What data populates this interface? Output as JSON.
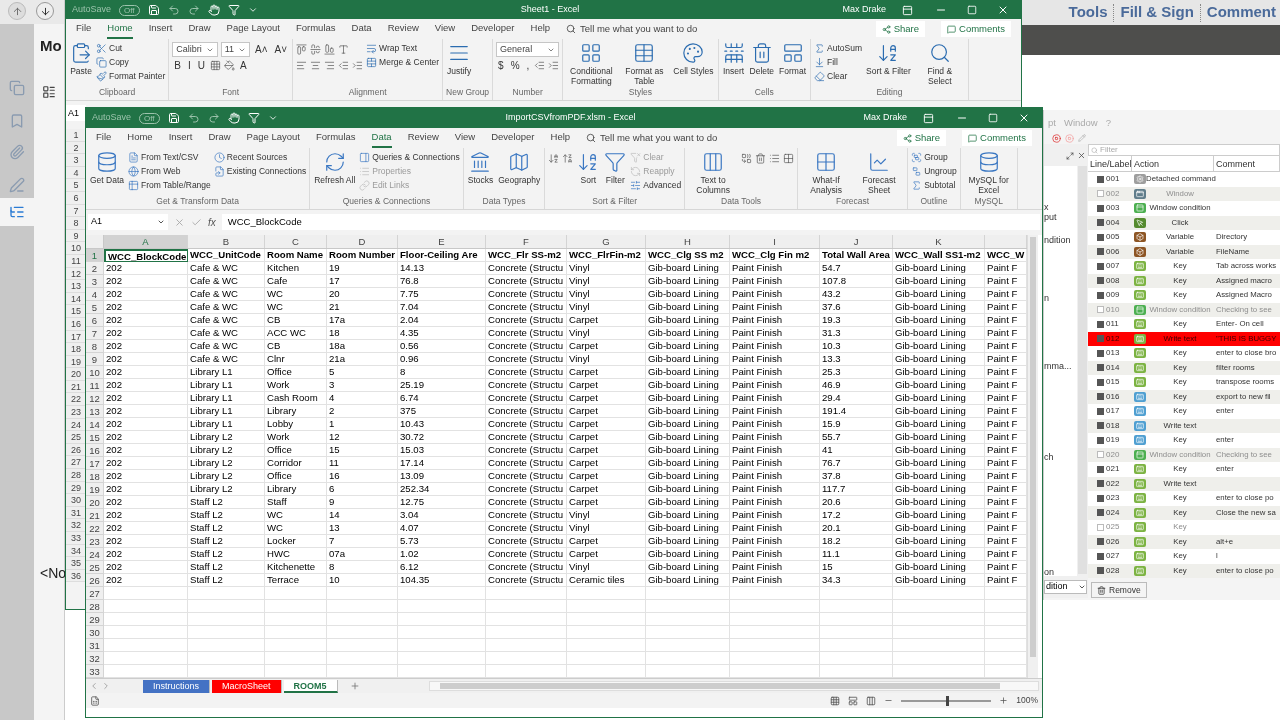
{
  "pdf_viewer": {
    "toolbar": [
      "Tools",
      "Fill & Sign",
      "Comment"
    ],
    "panel_title": "Mo",
    "panel_note": "<No",
    "side_tabs": [
      {
        "selected": false
      },
      {
        "selected": false
      },
      {
        "selected": false
      },
      {
        "selected": false
      },
      {
        "selected": true
      }
    ]
  },
  "back_window": {
    "autosave": "AutoSave",
    "autosave_state": "Off",
    "title": "Sheet1  -  Excel",
    "user": "Max Drake",
    "tabs": [
      {
        "label": "File",
        "selected": false
      },
      {
        "label": "Home",
        "selected": true
      },
      {
        "label": "Insert",
        "selected": false
      },
      {
        "label": "Draw",
        "selected": false
      },
      {
        "label": "Page Layout",
        "selected": false
      },
      {
        "label": "Formulas",
        "selected": false
      },
      {
        "label": "Data",
        "selected": false
      },
      {
        "label": "Review",
        "selected": false
      },
      {
        "label": "View",
        "selected": false
      },
      {
        "label": "Developer",
        "selected": false
      },
      {
        "label": "Help",
        "selected": false
      }
    ],
    "search": "Tell me what you want to do",
    "share": "Share",
    "comments": "Comments",
    "ribbon": [
      {
        "label": "Clipboard",
        "columns": [
          [
            {
              "kind": "large",
              "label": "Paste"
            }
          ],
          [
            {
              "kind": "small",
              "label": "Cut"
            },
            {
              "kind": "small",
              "label": "Copy"
            },
            {
              "kind": "small",
              "label": "Format Painter"
            }
          ]
        ]
      },
      {
        "label": "Font",
        "columns": [
          [
            {
              "kind": "row",
              "items": [
                {
                  "kind": "field",
                  "value": "Calibri"
                },
                {
                  "kind": "field",
                  "value": "11"
                },
                {
                  "kind": "glyphs",
                  "glyphs": [
                    "A˄",
                    "A˅"
                  ]
                }
              ]
            },
            {
              "kind": "row",
              "items": [
                {
                  "kind": "glyphs",
                  "glyphs": [
                    "B",
                    "I",
                    "U"
                  ]
                },
                {
                  "kind": "iconrow"
                },
                {
                  "kind": "glyphs",
                  "glyphs": [
                    "A"
                  ]
                }
              ]
            }
          ]
        ]
      },
      {
        "label": "Alignment",
        "columns": [
          [
            {
              "kind": "iconrow"
            },
            {
              "kind": "iconrow"
            }
          ],
          [
            {
              "kind": "small",
              "label": "Wrap Text"
            },
            {
              "kind": "small",
              "label": "Merge & Center"
            }
          ]
        ]
      },
      {
        "label": "New Group",
        "columns": [
          [
            {
              "kind": "large",
              "label": "Justify"
            }
          ]
        ]
      },
      {
        "label": "Number",
        "columns": [
          [
            {
              "kind": "field",
              "value": "General"
            },
            {
              "kind": "row",
              "items": [
                {
                  "kind": "glyphs",
                  "glyphs": [
                    "$",
                    "%",
                    ","
                  ]
                },
                {
                  "kind": "iconrow"
                }
              ]
            }
          ]
        ]
      },
      {
        "label": "Styles",
        "columns": [
          [
            {
              "kind": "large",
              "label": "Conditional Formatting"
            }
          ],
          [
            {
              "kind": "large",
              "label": "Format as Table"
            }
          ],
          [
            {
              "kind": "large",
              "label": "Cell Styles"
            }
          ]
        ]
      },
      {
        "label": "Cells",
        "columns": [
          [
            {
              "kind": "large",
              "label": "Insert"
            }
          ],
          [
            {
              "kind": "large",
              "label": "Delete"
            }
          ],
          [
            {
              "kind": "large",
              "label": "Format"
            }
          ]
        ]
      },
      {
        "label": "Editing",
        "columns": [
          [
            {
              "kind": "small",
              "label": "AutoSum"
            },
            {
              "kind": "small",
              "label": "Fill"
            },
            {
              "kind": "small",
              "label": "Clear"
            }
          ],
          [
            {
              "kind": "large",
              "label": "Sort & Filter"
            }
          ],
          [
            {
              "kind": "large",
              "label": "Find & Select"
            }
          ]
        ]
      }
    ],
    "name_box": "A1",
    "row_numbers": [
      "1",
      "2",
      "3",
      "4",
      "5",
      "6",
      "7",
      "8",
      "9",
      "10",
      "11",
      "12",
      "13",
      "14",
      "15",
      "16",
      "17",
      "18",
      "19",
      "20",
      "21",
      "22",
      "23",
      "24",
      "25",
      "26",
      "27",
      "28",
      "29",
      "30",
      "31",
      "32",
      "33",
      "34",
      "35",
      "36"
    ]
  },
  "front_window": {
    "autosave": "AutoSave",
    "autosave_state": "Off",
    "title": "ImportCSVfromPDF.xlsm  -  Excel",
    "user": "Max Drake",
    "tabs": [
      {
        "label": "File",
        "selected": false
      },
      {
        "label": "Home",
        "selected": false
      },
      {
        "label": "Insert",
        "selected": false
      },
      {
        "label": "Draw",
        "selected": false
      },
      {
        "label": "Page Layout",
        "selected": false
      },
      {
        "label": "Formulas",
        "selected": false
      },
      {
        "label": "Data",
        "selected": true
      },
      {
        "label": "Review",
        "selected": false
      },
      {
        "label": "View",
        "selected": false
      },
      {
        "label": "Developer",
        "selected": false
      },
      {
        "label": "Help",
        "selected": false
      }
    ],
    "search": "Tell me what you want to do",
    "share": "Share",
    "comments": "Comments",
    "ribbon": [
      {
        "label": "Get & Transform Data",
        "columns": [
          [
            {
              "kind": "large",
              "label": "Get Data",
              "disabled": false
            }
          ],
          [
            {
              "kind": "small",
              "label": "From Text/CSV",
              "disabled": false
            },
            {
              "kind": "small",
              "label": "From Web",
              "disabled": false
            },
            {
              "kind": "small",
              "label": "From Table/Range",
              "disabled": false
            }
          ],
          [
            {
              "kind": "small",
              "label": "Recent Sources",
              "disabled": false
            },
            {
              "kind": "small",
              "label": "Existing Connections",
              "disabled": false
            }
          ]
        ]
      },
      {
        "label": "Queries & Connections",
        "columns": [
          [
            {
              "kind": "large",
              "label": "Refresh All",
              "disabled": false
            }
          ],
          [
            {
              "kind": "small",
              "label": "Queries & Connections",
              "disabled": false
            },
            {
              "kind": "small",
              "label": "Properties",
              "disabled": true
            },
            {
              "kind": "small",
              "label": "Edit Links",
              "disabled": true
            }
          ]
        ]
      },
      {
        "label": "Data Types",
        "columns": [
          [
            {
              "kind": "large",
              "label": "Stocks",
              "disabled": false
            }
          ],
          [
            {
              "kind": "large",
              "label": "Geography",
              "disabled": false
            }
          ]
        ]
      },
      {
        "label": "Sort & Filter",
        "columns": [
          [
            {
              "kind": "iconrow"
            }
          ],
          [
            {
              "kind": "large",
              "label": "Sort",
              "disabled": false
            }
          ],
          [
            {
              "kind": "large",
              "label": "Filter",
              "disabled": false
            }
          ],
          [
            {
              "kind": "small",
              "label": "Clear",
              "disabled": true
            },
            {
              "kind": "small",
              "label": "Reapply",
              "disabled": true
            },
            {
              "kind": "small",
              "label": "Advanced",
              "disabled": false
            }
          ]
        ]
      },
      {
        "label": "Data Tools",
        "columns": [
          [
            {
              "kind": "large",
              "label": "Text to Columns",
              "disabled": false
            }
          ],
          [
            {
              "kind": "iconrow"
            }
          ]
        ]
      },
      {
        "label": "Forecast",
        "columns": [
          [
            {
              "kind": "large",
              "label": "What-If Analysis",
              "disabled": false
            }
          ],
          [
            {
              "kind": "large",
              "label": "Forecast Sheet",
              "disabled": false
            }
          ]
        ]
      },
      {
        "label": "Outline",
        "columns": [
          [
            {
              "kind": "small",
              "label": "Group",
              "disabled": false
            },
            {
              "kind": "small",
              "label": "Ungroup",
              "disabled": false
            },
            {
              "kind": "small",
              "label": "Subtotal",
              "disabled": false
            }
          ]
        ]
      },
      {
        "label": "MySQL",
        "columns": [
          [
            {
              "kind": "large",
              "label": "MySQL for Excel",
              "disabled": false
            }
          ]
        ]
      }
    ],
    "name_box": "A1",
    "formula_label": "fx",
    "formula": "WCC_BlockCode",
    "column_letters": [
      "A",
      "B",
      "C",
      "D",
      "E",
      "F",
      "G",
      "H",
      "I",
      "J",
      "K"
    ],
    "rows": [
      {
        "n": "1",
        "cells": [
          "WCC_BlockCode",
          "WCC_UnitCode",
          "Room Name",
          "Room Number",
          "Floor-Ceiling Are",
          "WCC_Flr SS-m2",
          "WCC_FlrFin-m2",
          "WCC_Clg SS m2",
          "WCC_Clg Fin m2",
          "Total Wall Area",
          "WCC_Wall SS1-m2",
          "WCC_W"
        ]
      },
      {
        "n": "2",
        "cells": [
          "202",
          "Cafe & WC",
          "Kitchen",
          "19",
          "14.13",
          "Concrete (Structu",
          "Vinyl",
          "Gib-board Lining",
          "Paint Finish",
          "54.7",
          "Gib-board Lining",
          "Paint F"
        ]
      },
      {
        "n": "3",
        "cells": [
          "202",
          "Cafe & WC",
          "Cafe",
          "17",
          "76.8",
          "Concrete (Structu",
          "Vinyl",
          "Gib-board Lining",
          "Paint Finish",
          "107.8",
          "Gib-board Lining",
          "Paint F"
        ]
      },
      {
        "n": "4",
        "cells": [
          "202",
          "Cafe & WC",
          "WC",
          "20",
          "7.75",
          "Concrete (Structu",
          "Vinyl",
          "Gib-board Lining",
          "Paint Finish",
          "43.2",
          "Gib-board Lining",
          "Paint F"
        ]
      },
      {
        "n": "5",
        "cells": [
          "202",
          "Cafe & WC",
          "WC",
          "21",
          "7.04",
          "Concrete (Structu",
          "Vinyl",
          "Gib-board Lining",
          "Paint Finish",
          "37.6",
          "Gib-board Lining",
          "Paint F"
        ]
      },
      {
        "n": "6",
        "cells": [
          "202",
          "Cafe & WC",
          "CB",
          "17a",
          "2.04",
          "Concrete (Structu",
          "Carpet",
          "Gib-board Lining",
          "Paint Finish",
          "19.3",
          "Gib-board Lining",
          "Paint F"
        ]
      },
      {
        "n": "7",
        "cells": [
          "202",
          "Cafe & WC",
          "ACC WC",
          "18",
          "4.35",
          "Concrete (Structu",
          "Vinyl",
          "Gib-board Lining",
          "Paint Finish",
          "31.3",
          "Gib-board Lining",
          "Paint F"
        ]
      },
      {
        "n": "8",
        "cells": [
          "202",
          "Cafe & WC",
          "CB",
          "18a",
          "0.56",
          "Concrete (Structu",
          "Carpet",
          "Gib-board Lining",
          "Paint Finish",
          "10.3",
          "Gib-board Lining",
          "Paint F"
        ]
      },
      {
        "n": "9",
        "cells": [
          "202",
          "Cafe & WC",
          "Clnr",
          "21a",
          "0.96",
          "Concrete (Structu",
          "Vinyl",
          "Gib-board Lining",
          "Paint Finish",
          "13.3",
          "Gib-board Lining",
          "Paint F"
        ]
      },
      {
        "n": "10",
        "cells": [
          "202",
          "Library L1",
          "Office",
          "5",
          "8",
          "Concrete (Structu",
          "Carpet",
          "Gib-board Lining",
          "Paint Finish",
          "25.3",
          "Gib-board Lining",
          "Paint F"
        ]
      },
      {
        "n": "11",
        "cells": [
          "202",
          "Library L1",
          "Work",
          "3",
          "25.19",
          "Concrete (Structu",
          "Carpet",
          "Gib-board Lining",
          "Paint Finish",
          "46.9",
          "Gib-board Lining",
          "Paint F"
        ]
      },
      {
        "n": "12",
        "cells": [
          "202",
          "Library L1",
          "Cash Room",
          "4",
          "6.74",
          "Concrete (Structu",
          "Carpet",
          "Gib-board Lining",
          "Paint Finish",
          "29.4",
          "Gib-board Lining",
          "Paint F"
        ]
      },
      {
        "n": "13",
        "cells": [
          "202",
          "Library L1",
          "Library",
          "2",
          "375",
          "Concrete (Structu",
          "Carpet",
          "Gib-board Lining",
          "Paint Finish",
          "191.4",
          "Gib-board Lining",
          "Paint F"
        ]
      },
      {
        "n": "14",
        "cells": [
          "202",
          "Library L1",
          "Lobby",
          "1",
          "10.43",
          "Concrete (Structu",
          "Carpet",
          "Gib-board Lining",
          "Paint Finish",
          "15.9",
          "Gib-board Lining",
          "Paint F"
        ]
      },
      {
        "n": "15",
        "cells": [
          "202",
          "Library L2",
          "Work",
          "12",
          "30.72",
          "Concrete (Structu",
          "Carpet",
          "Gib-board Lining",
          "Paint Finish",
          "55.7",
          "Gib-board Lining",
          "Paint F"
        ]
      },
      {
        "n": "16",
        "cells": [
          "202",
          "Library L2",
          "Office",
          "15",
          "15.03",
          "Concrete (Structu",
          "Carpet",
          "Gib-board Lining",
          "Paint Finish",
          "41",
          "Gib-board Lining",
          "Paint F"
        ]
      },
      {
        "n": "17",
        "cells": [
          "202",
          "Library L2",
          "Corridor",
          "11",
          "17.14",
          "Concrete (Structu",
          "Carpet",
          "Gib-board Lining",
          "Paint Finish",
          "76.7",
          "Gib-board Lining",
          "Paint F"
        ]
      },
      {
        "n": "18",
        "cells": [
          "202",
          "Library L2",
          "Office",
          "16",
          "13.09",
          "Concrete (Structu",
          "Carpet",
          "Gib-board Lining",
          "Paint Finish",
          "37.8",
          "Gib-board Lining",
          "Paint F"
        ]
      },
      {
        "n": "19",
        "cells": [
          "202",
          "Library L2",
          "Library",
          "6",
          "252.34",
          "Concrete (Structu",
          "Carpet",
          "Gib-board Lining",
          "Paint Finish",
          "117.7",
          "Gib-board Lining",
          "Paint F"
        ]
      },
      {
        "n": "20",
        "cells": [
          "202",
          "Staff L2",
          "Staff",
          "9",
          "12.75",
          "Concrete (Structu",
          "Carpet",
          "Gib-board Lining",
          "Paint Finish",
          "20.6",
          "Gib-board Lining",
          "Paint F"
        ]
      },
      {
        "n": "21",
        "cells": [
          "202",
          "Staff L2",
          "WC",
          "14",
          "3.04",
          "Concrete (Structu",
          "Vinyl",
          "Gib-board Lining",
          "Paint Finish",
          "17.2",
          "Gib-board Lining",
          "Paint F"
        ]
      },
      {
        "n": "22",
        "cells": [
          "202",
          "Staff L2",
          "WC",
          "13",
          "4.07",
          "Concrete (Structu",
          "Vinyl",
          "Gib-board Lining",
          "Paint Finish",
          "20.1",
          "Gib-board Lining",
          "Paint F"
        ]
      },
      {
        "n": "23",
        "cells": [
          "202",
          "Staff L2",
          "Locker",
          "7",
          "5.73",
          "Concrete (Structu",
          "Carpet",
          "Gib-board Lining",
          "Paint Finish",
          "18.2",
          "Gib-board Lining",
          "Paint F"
        ]
      },
      {
        "n": "24",
        "cells": [
          "202",
          "Staff L2",
          "HWC",
          "07a",
          "1.02",
          "Concrete (Structu",
          "Carpet",
          "Gib-board Lining",
          "Paint Finish",
          "11.1",
          "Gib-board Lining",
          "Paint F"
        ]
      },
      {
        "n": "25",
        "cells": [
          "202",
          "Staff L2",
          "Kitchenette",
          "8",
          "6.12",
          "Concrete (Structu",
          "Vinyl",
          "Gib-board Lining",
          "Paint Finish",
          "15",
          "Gib-board Lining",
          "Paint F"
        ]
      },
      {
        "n": "26",
        "cells": [
          "202",
          "Staff L2",
          "Terrace",
          "10",
          "104.35",
          "Concrete (Structu",
          "Ceramic tiles",
          "Gib-board Lining",
          "Paint Finish",
          "34.3",
          "Gib-board Lining",
          "Paint F"
        ]
      },
      {
        "n": "27"
      },
      {
        "n": "28"
      },
      {
        "n": "29"
      },
      {
        "n": "30"
      },
      {
        "n": "31"
      },
      {
        "n": "32"
      },
      {
        "n": "33"
      }
    ],
    "sheets": [
      {
        "label": "Instructions",
        "color": "#4472c4",
        "selected": false
      },
      {
        "label": "MacroSheet",
        "color": "#ff0000",
        "selected": false
      },
      {
        "label": "ROOM5",
        "color": "#217346",
        "selected": true
      }
    ],
    "zoom": {
      "level": 0.5,
      "reading": "100%"
    }
  },
  "macro_tool": {
    "menu": [
      "pt",
      "Window",
      "?"
    ],
    "side_items": [
      "x",
      "put",
      "ndition",
      "n",
      "mma...",
      "ch",
      "on"
    ],
    "side_dropdown": "dition",
    "filter_placeholder": "Filter",
    "columns": [
      "Line/Label",
      "Action",
      "Comment"
    ],
    "steps": [
      {
        "line": "001",
        "checked": true,
        "kind": "detached",
        "color": "#9e9e9e",
        "action": "Detached command",
        "highlighted": false
      },
      {
        "line": "002",
        "checked": false,
        "kind": "window",
        "color": "#607d8b",
        "action": "Window",
        "highlighted": false
      },
      {
        "line": "003",
        "checked": true,
        "kind": "condition",
        "color": "#4caf50",
        "action": "Window condition",
        "highlighted": false
      },
      {
        "line": "004",
        "checked": true,
        "kind": "click",
        "color": "#558b2f",
        "action": "Click",
        "highlighted": false
      },
      {
        "line": "005",
        "checked": true,
        "kind": "variable",
        "color": "#8d5524",
        "action": "Variable",
        "comment": "Directory",
        "highlighted": false
      },
      {
        "line": "006",
        "checked": true,
        "kind": "variable",
        "color": "#8d5524",
        "action": "Variable",
        "comment": "FileName",
        "highlighted": false
      },
      {
        "line": "007",
        "checked": true,
        "kind": "key",
        "color": "#7cb342",
        "action": "Key",
        "comment": "Tab across works",
        "highlighted": false
      },
      {
        "line": "008",
        "checked": true,
        "kind": "key",
        "color": "#7cb342",
        "action": "Key",
        "comment": "Assigned macro",
        "highlighted": false
      },
      {
        "line": "009",
        "checked": true,
        "kind": "key",
        "color": "#7cb342",
        "action": "Key",
        "comment": "Assigned Macro",
        "highlighted": false
      },
      {
        "line": "010",
        "checked": false,
        "kind": "condition",
        "color": "#4caf50",
        "action": "Window condition",
        "comment": "Checking to see",
        "highlighted": false
      },
      {
        "line": "011",
        "checked": true,
        "kind": "key",
        "color": "#7cb342",
        "action": "Key",
        "comment": "Enter- On cell",
        "highlighted": false
      },
      {
        "line": "012",
        "checked": true,
        "kind": "key",
        "color": "#7cb342",
        "action": "Write text",
        "comment": "\"THIS IS BUGGY",
        "highlighted": true
      },
      {
        "line": "013",
        "checked": true,
        "kind": "key",
        "color": "#7cb342",
        "action": "Key",
        "comment": "enter to close bro",
        "highlighted": false
      },
      {
        "line": "014",
        "checked": true,
        "kind": "key",
        "color": "#7cb342",
        "action": "Key",
        "comment": "filter rooms",
        "highlighted": false
      },
      {
        "line": "015",
        "checked": true,
        "kind": "key",
        "color": "#7cb342",
        "action": "Key",
        "comment": "transpose rooms",
        "highlighted": false
      },
      {
        "line": "016",
        "checked": true,
        "kind": "key",
        "color": "#4f9fd1",
        "action": "Key",
        "comment": "export to new fil",
        "highlighted": false
      },
      {
        "line": "017",
        "checked": true,
        "kind": "key",
        "color": "#4f9fd1",
        "action": "Key",
        "comment": "enter",
        "highlighted": false
      },
      {
        "line": "018",
        "checked": true,
        "kind": "key",
        "color": "#4f9fd1",
        "action": "Write text",
        "highlighted": false
      },
      {
        "line": "019",
        "checked": true,
        "kind": "key",
        "color": "#4f9fd1",
        "action": "Key",
        "comment": "enter",
        "highlighted": false
      },
      {
        "line": "020",
        "checked": false,
        "kind": "condition",
        "color": "#4caf50",
        "action": "Window condition",
        "comment": "Checking to see",
        "highlighted": false
      },
      {
        "line": "021",
        "checked": true,
        "kind": "key",
        "color": "#7cb342",
        "action": "Key",
        "comment": "enter",
        "highlighted": false
      },
      {
        "line": "022",
        "checked": true,
        "kind": "key",
        "color": "#7cb342",
        "action": "Write text",
        "highlighted": false
      },
      {
        "line": "023",
        "checked": true,
        "kind": "key",
        "color": "#7cb342",
        "action": "Key",
        "comment": "enter to close po",
        "highlighted": false
      },
      {
        "line": "024",
        "checked": true,
        "kind": "key",
        "color": "#7cb342",
        "action": "Key",
        "comment": "Close the new sa",
        "highlighted": false
      },
      {
        "line": "025",
        "checked": false,
        "kind": "key",
        "color": "#7cb342",
        "action": "Key",
        "highlighted": false
      },
      {
        "line": "026",
        "checked": true,
        "kind": "key",
        "color": "#7cb342",
        "action": "Key",
        "comment": "alt+e",
        "highlighted": false
      },
      {
        "line": "027",
        "checked": true,
        "kind": "key",
        "color": "#7cb342",
        "action": "Key",
        "comment": "l",
        "highlighted": false
      },
      {
        "line": "028",
        "checked": true,
        "kind": "key",
        "color": "#7cb342",
        "action": "Key",
        "comment": "enter to close po",
        "highlighted": false
      }
    ],
    "remove": "Remove"
  }
}
